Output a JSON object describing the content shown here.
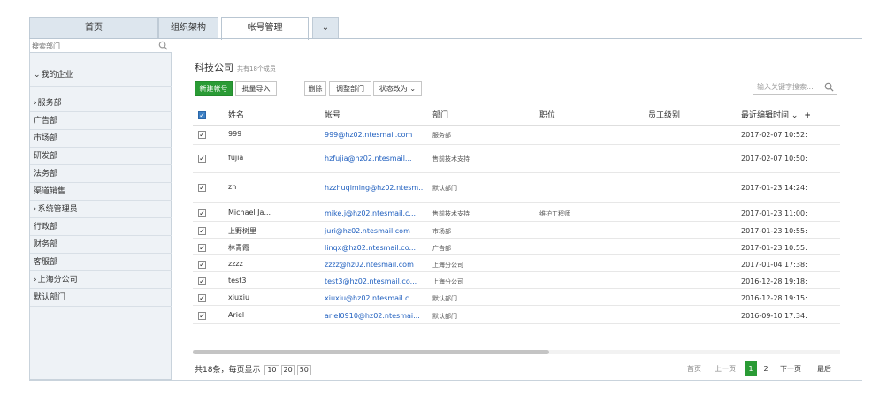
{
  "tabs": [
    {
      "label": "首页"
    },
    {
      "label": "组织架构"
    },
    {
      "label": "帐号管理",
      "active": true
    },
    {
      "label": "⌄"
    }
  ],
  "sidebar": {
    "search_placeholder": "搜索部门",
    "items": [
      {
        "label": "我的企业",
        "prefix": "⌄"
      },
      {
        "label": "服务部",
        "prefix": "›"
      },
      {
        "label": "广告部"
      },
      {
        "label": "市场部"
      },
      {
        "label": "研发部"
      },
      {
        "label": "法务部"
      },
      {
        "label": "渠道销售"
      },
      {
        "label": "系统管理员",
        "prefix": "›"
      },
      {
        "label": "行政部"
      },
      {
        "label": "财务部"
      },
      {
        "label": "客服部"
      },
      {
        "label": "上海分公司",
        "prefix": "›"
      },
      {
        "label": "默认部门"
      }
    ]
  },
  "main": {
    "company_name": "科技公司",
    "member_count": "共有18个成员",
    "buttons": {
      "new_account": "新建帐号",
      "batch_import": "批量导入",
      "delete": "删除",
      "adjust_dept": "调整部门",
      "change_status": "状态改为 ⌄"
    },
    "keyword_placeholder": "输入关键字搜索...",
    "columns": {
      "name": "姓名",
      "account": "帐号",
      "dept": "部门",
      "position": "职位",
      "level": "员工级别",
      "last_edit": "最近编辑时间",
      "sort": "⌄",
      "add": "+"
    },
    "rows": [
      {
        "name": "999",
        "account": "999@hz02.ntesmail.com",
        "dept": "服务部",
        "position": "",
        "level": "",
        "time": "2017-02-07 10:52:"
      },
      {
        "name": "fujia",
        "account": "hzfujia@hz02.ntesmail...",
        "dept": "售前技术支持",
        "position": "",
        "level": "",
        "time": "2017-02-07 10:50:"
      },
      {
        "name": "zh",
        "account": "hzzhuqiming@hz02.ntesm...",
        "dept": "默认部门",
        "position": "",
        "level": "",
        "time": "2017-01-23 14:24:"
      },
      {
        "name": "Michael Ja...",
        "account": "mike.j@hz02.ntesmail.c...",
        "dept": "售前技术支持",
        "position": "维护工程师",
        "level": "",
        "time": "2017-01-23 11:00:"
      },
      {
        "name": "上野树里",
        "account": "juri@hz02.ntesmail.com",
        "dept": "市场部",
        "position": "",
        "level": "",
        "time": "2017-01-23 10:55:"
      },
      {
        "name": "林青霞",
        "account": "linqx@hz02.ntesmail.co...",
        "dept": "广告部",
        "position": "",
        "level": "",
        "time": "2017-01-23 10:55:"
      },
      {
        "name": "zzzz",
        "account": "zzzz@hz02.ntesmail.com",
        "dept": "上海分公司",
        "position": "",
        "level": "",
        "time": "2017-01-04 17:38:"
      },
      {
        "name": "test3",
        "account": "test3@hz02.ntesmail.co...",
        "dept": "上海分公司",
        "position": "",
        "level": "",
        "time": "2016-12-28 19:18:"
      },
      {
        "name": "xiuxiu",
        "account": "xiuxiu@hz02.ntesmail.c...",
        "dept": "默认部门",
        "position": "",
        "level": "",
        "time": "2016-12-28 19:15:"
      },
      {
        "name": "Ariel",
        "account": "ariel0910@hz02.ntesmai...",
        "dept": "默认部门",
        "position": "",
        "level": "",
        "time": "2016-09-10 17:34:"
      }
    ],
    "footer": {
      "total_text": "共18条，每页显示",
      "page_sizes": [
        "10",
        "20",
        "50"
      ],
      "first": "首页",
      "prev": "上一页",
      "pages": [
        "1",
        "2"
      ],
      "current_page": "1",
      "next": "下一页",
      "last": "最后"
    }
  },
  "colors": {
    "accent_green": "#2a9b35",
    "link_blue": "#1f5fbf",
    "tab_bg": "#dde6ee",
    "sidebar_bg": "#eef2f6"
  }
}
